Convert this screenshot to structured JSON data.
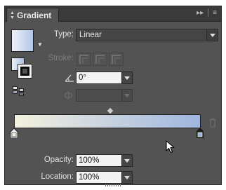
{
  "panel": {
    "title": "Gradient",
    "menu_icons": [
      "expand-icon",
      "panel-menu-icon"
    ]
  },
  "type": {
    "label": "Type:",
    "value": "Linear"
  },
  "stroke": {
    "label": "Stroke:",
    "buttons": [
      "stroke-within-icon",
      "stroke-along-icon",
      "stroke-across-icon"
    ]
  },
  "angle": {
    "icon": "angle-icon",
    "value": "0°"
  },
  "aspect_ratio": {
    "icon": "aspect-ratio-icon",
    "value": ""
  },
  "gradient": {
    "start_color": "#f4f1df",
    "end_color": "#9fb6e0"
  },
  "opacity": {
    "label": "Opacity:",
    "value": "100%"
  },
  "location": {
    "label": "Location:",
    "value": "100%"
  }
}
